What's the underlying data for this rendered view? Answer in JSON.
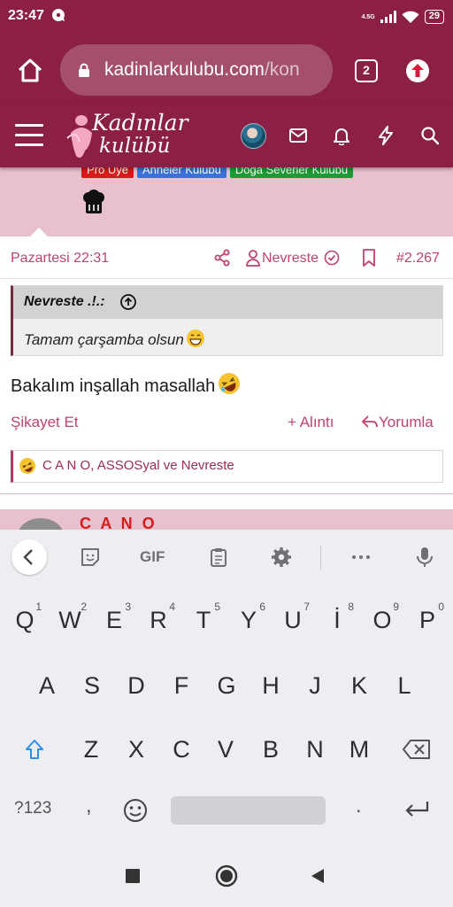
{
  "status": {
    "time": "23:47",
    "network": "4.5G",
    "battery": "29"
  },
  "browser": {
    "url_main": "kadinlarkulubu.com",
    "url_rest": "/kon",
    "tab_count": "2"
  },
  "site": {
    "logo_line1": "Kadınlar",
    "logo_line2": "kulübü"
  },
  "prev_user": {
    "badges": [
      "Pro Üye",
      "Anneler Kulübü",
      "Doğa Severler Kulübü"
    ]
  },
  "post": {
    "date": "Pazartesi 22:31",
    "author": "Nevreste",
    "number": "#2.267",
    "quote_author": "Nevreste .!.:",
    "quote_text": "Tamam çarşamba olsun",
    "body": "Bakalım inşallah masallah",
    "report": "Şikayet Et",
    "quote_action": "+ Alıntı",
    "reply_action": "Yorumla",
    "reactions_text": "C A N O, ASSOSyal ve Nevreste"
  },
  "next_post": {
    "username": "C A N O"
  },
  "keyboard": {
    "row1": [
      "Q",
      "W",
      "E",
      "R",
      "T",
      "Y",
      "U",
      "İ",
      "O",
      "P"
    ],
    "row1_hints": [
      "1",
      "2",
      "3",
      "4",
      "5",
      "6",
      "7",
      "8",
      "9",
      "0"
    ],
    "row2": [
      "A",
      "S",
      "D",
      "F",
      "G",
      "H",
      "J",
      "K",
      "L"
    ],
    "row3": [
      "Z",
      "X",
      "C",
      "V",
      "B",
      "N",
      "M"
    ],
    "sym_label": "?123",
    "comma": ",",
    "period": ".",
    "gif_label": "GIF"
  },
  "colors": {
    "brand": "#8b1f45",
    "accent": "#c1426a",
    "user_band": "#e9c1ce"
  }
}
